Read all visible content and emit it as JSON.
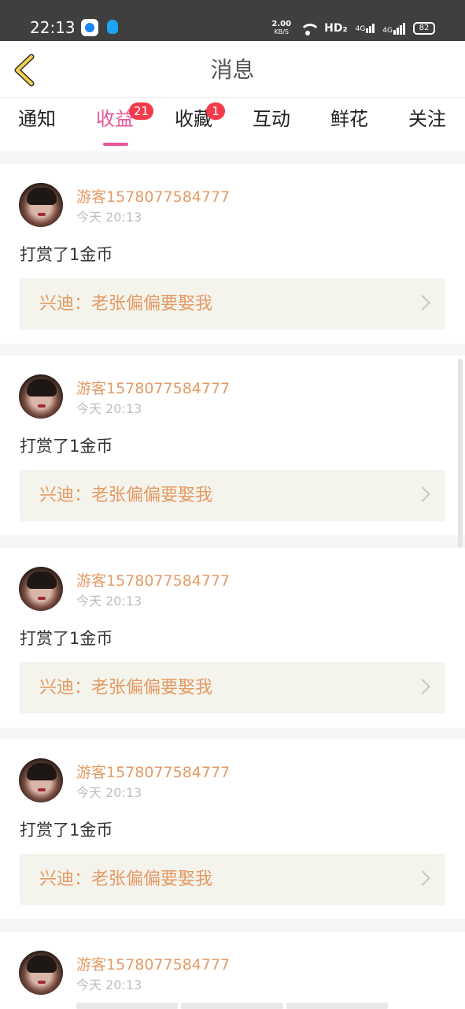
{
  "status_bar": {
    "time": "22:13",
    "speed_value": "2.00",
    "speed_unit": "KB/S",
    "hd_label": "HD₂",
    "network_1": "4G",
    "network_2": "4G",
    "battery": "82",
    "icons": [
      "chrome-like-icon",
      "qq-icon",
      "wifi-icon",
      "signal-icon",
      "battery-icon"
    ]
  },
  "header": {
    "title": "消息",
    "back_icon": "chevron-left-icon"
  },
  "tabs": [
    {
      "label": "通知"
    },
    {
      "label": "收益",
      "badge": "21",
      "active": true
    },
    {
      "label": "收藏",
      "badge": "1"
    },
    {
      "label": "互动"
    },
    {
      "label": "鲜花"
    },
    {
      "label": "关注"
    }
  ],
  "messages": [
    {
      "user": "游客1578077584777",
      "time": "今天 20:13",
      "action": "打赏了1金币",
      "work": "兴迪：老张偏偏要娶我"
    },
    {
      "user": "游客1578077584777",
      "time": "今天 20:13",
      "action": "打赏了1金币",
      "work": "兴迪：老张偏偏要娶我"
    },
    {
      "user": "游客1578077584777",
      "time": "今天 20:13",
      "action": "打赏了1金币",
      "work": "兴迪：老张偏偏要娶我"
    },
    {
      "user": "游客1578077584777",
      "time": "今天 20:13",
      "action": "打赏了1金币",
      "work": "兴迪：老张偏偏要娶我"
    },
    {
      "user": "游客1578077584777",
      "time": "今天 20:13"
    }
  ],
  "colors": {
    "accent_pink": "#e8579a",
    "badge_red": "#f33b4b",
    "username_orange": "#e59a64",
    "back_icon_yellow": "#f2cf52"
  }
}
